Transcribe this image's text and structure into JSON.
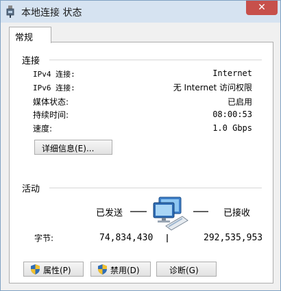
{
  "window": {
    "title": "本地连接 状态",
    "close_symbol": "✕"
  },
  "tabs": [
    {
      "label": "常规",
      "selected": true
    }
  ],
  "connection": {
    "heading": "连接",
    "rows": [
      {
        "label": "IPv4 连接:",
        "value": "Internet"
      },
      {
        "label": "IPv6 连接:",
        "value": "无 Internet 访问权限"
      },
      {
        "label": "媒体状态:",
        "value": "已启用"
      },
      {
        "label": "持续时间:",
        "value": "08:00:53"
      },
      {
        "label": "速度:",
        "value": "1.0 Gbps"
      }
    ],
    "details_button": "详细信息(E)..."
  },
  "activity": {
    "heading": "活动",
    "sent_label": "已发送",
    "received_label": "已接收",
    "bytes_label": "字节:",
    "bytes_sent": "74,834,430",
    "bytes_received": "292,535,953",
    "icon": "network-computers-icon"
  },
  "buttons": {
    "properties": "属性(P)",
    "disable": "禁用(D)",
    "diagnose": "诊断(G)",
    "shield_icon": "uac-shield-icon"
  }
}
